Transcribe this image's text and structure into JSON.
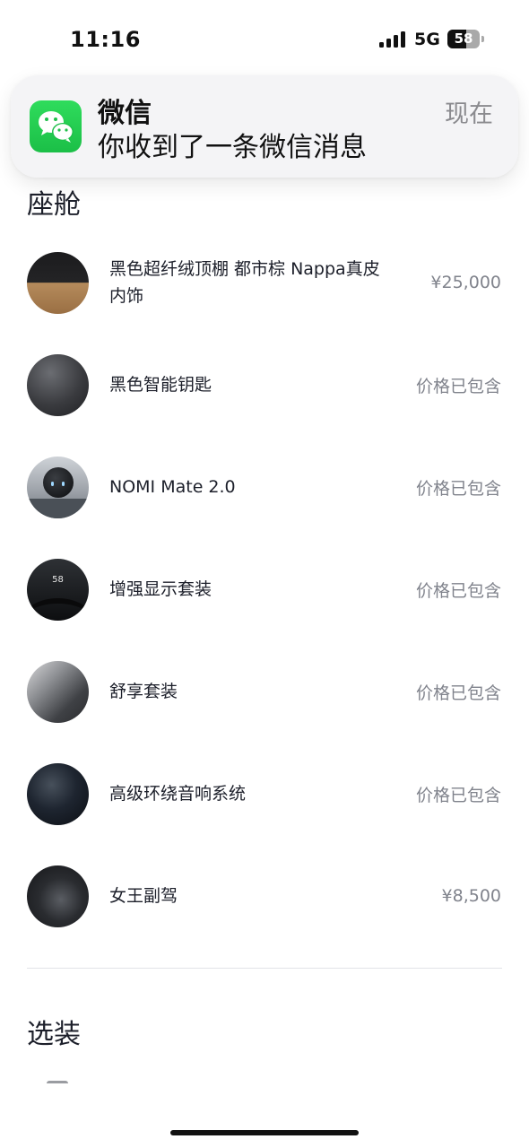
{
  "status_bar": {
    "time": "11:16",
    "network": "5G",
    "battery": "58"
  },
  "notification": {
    "app": "微信",
    "message": "你收到了一条微信消息",
    "time": "现在",
    "icon": "wechat-icon"
  },
  "cockpit": {
    "title": "座舱",
    "items": [
      {
        "name": "黑色超纤绒顶棚 都市棕 Nappa真皮内饰",
        "price": "¥25,000"
      },
      {
        "name": "黑色智能钥匙",
        "price": "价格已包含"
      },
      {
        "name": "NOMI Mate 2.0",
        "price": "价格已包含"
      },
      {
        "name": "增强显示套装",
        "price": "价格已包含",
        "thumb_text": "58"
      },
      {
        "name": "舒享套装",
        "price": "价格已包含"
      },
      {
        "name": "高级环绕音响系统",
        "price": "价格已包含"
      },
      {
        "name": "女王副驾",
        "price": "¥8,500"
      }
    ]
  },
  "options": {
    "title": "选装"
  }
}
